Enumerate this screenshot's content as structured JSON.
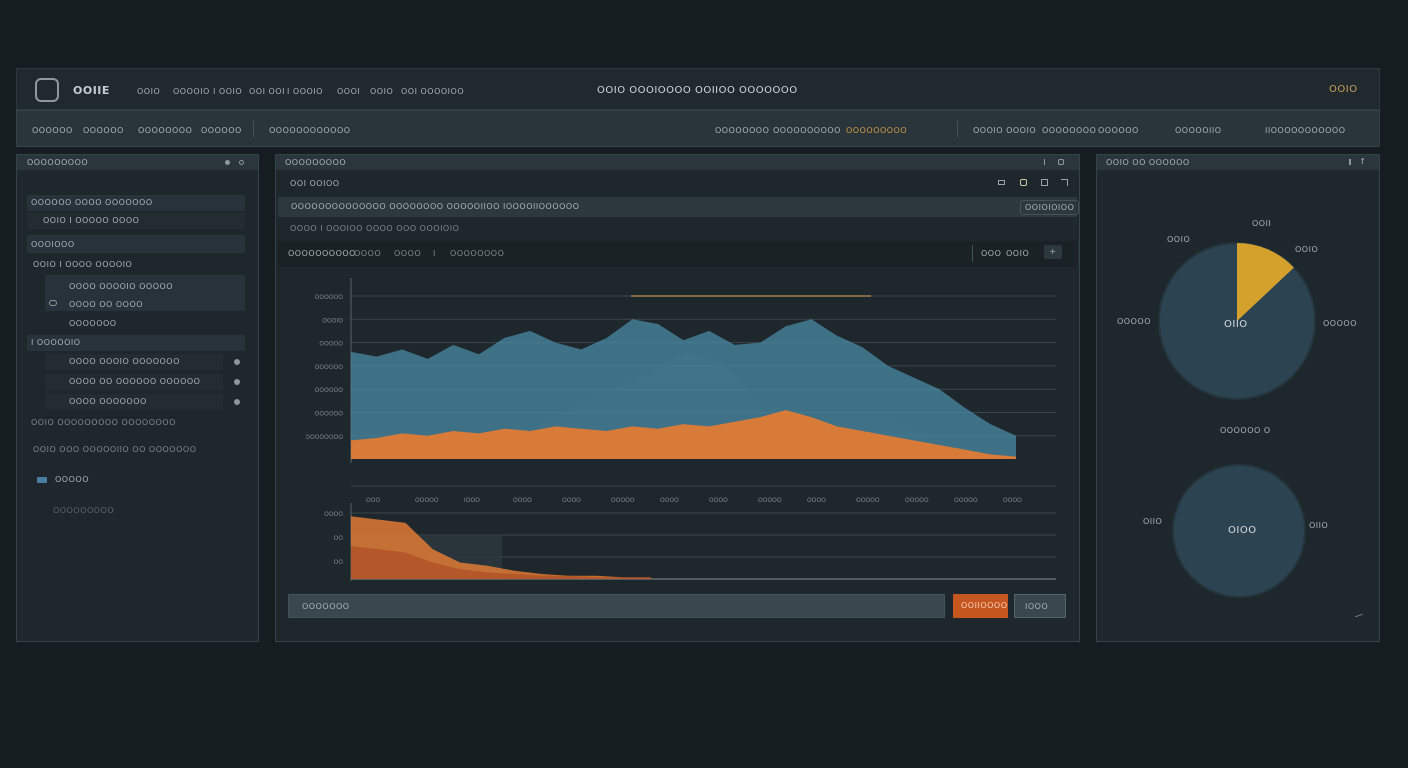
{
  "header": {
    "app_name": "OOIIE",
    "nav": [
      "OOIO",
      "OOOOIO",
      "I OOIO",
      "OOI OOI",
      "I OOOIO",
      "OOOI",
      "OOIO",
      "OOI OOOOIOO"
    ],
    "title": "OOIO OOOIOOOO OOIIOO OOOOOOO",
    "right_label": "OOIO"
  },
  "toolbar": {
    "left": [
      "OOOOOO",
      "OOOOOO",
      "OOOOOOOO",
      "OOOOOO"
    ],
    "search": "OOOOOOOOOOOO",
    "middle": [
      "OOOOOOOO",
      "OOOOOOOOOO"
    ],
    "active": "OOOOOOOOO",
    "right": [
      "OOOIO OOOIO",
      "OOOOOOOO",
      "OOOOOO",
      "OOOOOIIO",
      "IIOOOOOOOOOOO"
    ]
  },
  "sidebar": {
    "title": "OOOOOOOOO",
    "items": [
      "OOOOOO OOOO OOOOOOO",
      "OOIO I OOOOO OOOO",
      "OOOIOOO",
      "OOIO I OOOO OOOOIO",
      "OOOO OOOOIO OOOOO",
      "OOOO OO OOOO",
      "OOOOOOO",
      "I OOOOOIO",
      "OOOO OOOIO OOOOOOO",
      "OOOO OO OOOOOO OOOOOO",
      "OOOO OOOOOOO",
      "OOIO OOOOOOOOO OOOOOOOO",
      "OOIO OOO OOOOOIIO OO OOOOOOO",
      "OOOOO",
      "OOOOOOOOO"
    ]
  },
  "main": {
    "title": "OOOOOOOOO",
    "subtitle": "OOI OOIOO",
    "description": "OOOOOOOOOOOOOO OOOOOOOO OOOOOIIOO IOOOOIIOOOOOO",
    "description_badge": "OOIOIOIOO",
    "info": "OOOO I OOOIOO OOOO OOO OOOIOIO",
    "filters": [
      "OOOOOOOOOO",
      "OOOO",
      "OOOO",
      "I",
      "OOOOOOOO"
    ],
    "range": [
      "OOO",
      "OOIO"
    ],
    "input_label": "OOOOOOO",
    "primary_button": "OOIIOOOO",
    "secondary_button": "IOOO",
    "y_ticks_top": [
      "OOOOOO",
      "OOOIO",
      "OOOOO",
      "OOOOOO",
      "OOOOOO",
      "OOOOOO",
      "OOOOOOOO"
    ],
    "y_ticks_bottom": [
      "OOOO",
      "OO",
      "OO"
    ],
    "x_ticks": [
      "OOO",
      "OOOOO",
      "IOOO",
      "OOOO",
      "OOOO",
      "OOOOO",
      "OOOO",
      "OOOO",
      "OOOOO",
      "OOOO",
      "OOOOO",
      "OOOOO",
      "OOOOO",
      "OOOO"
    ]
  },
  "right_panel": {
    "title": "OOIO OO OOOOOO",
    "pie1": {
      "center": "OIIO",
      "labels": [
        "OOIO",
        "OOII",
        "OOIO",
        "OOOOO",
        "OOOOO"
      ],
      "highlight_fraction": 0.13
    },
    "caption": "OOOOOO O",
    "pie2": {
      "center": "OIOO",
      "labels": [
        "OIIO",
        "OIIO"
      ]
    }
  },
  "colors": {
    "accent_orange": "#e07a34",
    "accent_teal": "#4a8aa5",
    "accent_gold": "#d4a22c",
    "pie_fill": "#2c4452"
  },
  "chart_data": [
    {
      "type": "area",
      "title": "",
      "series": [
        {
          "values": [
            46,
            44,
            47,
            43,
            49,
            45,
            52,
            55,
            50,
            47,
            52,
            60,
            58,
            51,
            55,
            49,
            50,
            57,
            60,
            53,
            48,
            40,
            35,
            30,
            22,
            15,
            10
          ]
        },
        {
          "values": [
            8,
            9,
            11,
            10,
            12,
            11,
            13,
            12,
            14,
            13,
            12,
            14,
            13,
            15,
            14,
            16,
            18,
            21,
            18,
            14,
            12,
            10,
            8,
            6,
            4,
            2,
            1
          ]
        }
      ]
    },
    {
      "type": "area",
      "title": "",
      "series": [
        {
          "values": [
            38,
            36,
            34,
            18,
            10,
            8,
            5,
            3,
            2,
            2,
            1,
            1
          ]
        },
        {
          "values": [
            20,
            18,
            16,
            10,
            6,
            4,
            3,
            2,
            2,
            1,
            1,
            1
          ]
        }
      ]
    }
  ]
}
